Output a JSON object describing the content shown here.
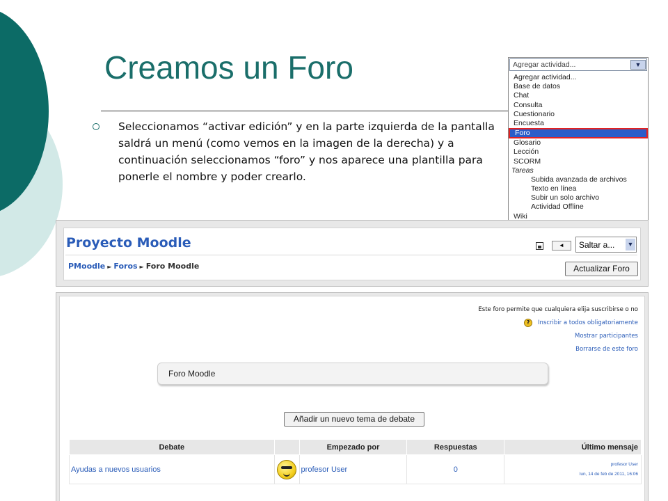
{
  "slide": {
    "title": "Creamos un Foro",
    "bullet": "Seleccionamos “activar edición” y en la parte izquierda de la pantalla saldrá un menú (como vemos en la imagen de la derecha) y a continuación seleccionamos “foro” y nos aparece una plantilla para ponerle el nombre y poder crearlo."
  },
  "activity_menu": {
    "placeholder": "Agregar actividad...",
    "items": [
      {
        "label": "Agregar actividad..."
      },
      {
        "label": "Base de datos"
      },
      {
        "label": "Chat"
      },
      {
        "label": "Consulta"
      },
      {
        "label": "Cuestionario"
      },
      {
        "label": "Encuesta"
      },
      {
        "label": "Foro",
        "selected": true
      },
      {
        "label": "Glosario"
      },
      {
        "label": "Lección"
      },
      {
        "label": "SCORM"
      },
      {
        "label": "Tareas",
        "group": true
      },
      {
        "label": "Subida avanzada de archivos",
        "indent": true
      },
      {
        "label": "Texto en línea",
        "indent": true
      },
      {
        "label": "Subir un solo archivo",
        "indent": true
      },
      {
        "label": "Actividad Offline",
        "indent": true
      },
      {
        "label": "Wiki"
      }
    ]
  },
  "moodle": {
    "site_title": "Proyecto Moodle",
    "jump_select": "Saltar a...",
    "prev_icon": "◄",
    "breadcrumb": {
      "home": "PMoodle",
      "section": "Foros",
      "current": "Foro Moodle",
      "sep": "►"
    },
    "update_button": "Actualizar Foro",
    "subscription_note": "Este foro permite que cualquiera elija suscribirse o no",
    "help_icon": "?",
    "links": {
      "subscribe_all": "Inscribir a todos obligatoriamente",
      "show_participants": "Mostrar participantes",
      "unsubscribe": "Borrarse de este foro"
    },
    "forum_name": "Foro Moodle",
    "add_topic_button": "Añadir un nuevo tema de debate",
    "table": {
      "headers": {
        "debate": "Debate",
        "started_by": "Empezado por",
        "replies": "Respuestas",
        "last_post": "Último mensaje"
      },
      "rows": [
        {
          "debate": "Ayudas a nuevos usuarios",
          "started_by": "profesor User",
          "replies": "0",
          "last_user": "profesor User",
          "last_date": "lun, 14 de feb de 2011, 16:06"
        }
      ]
    }
  }
}
